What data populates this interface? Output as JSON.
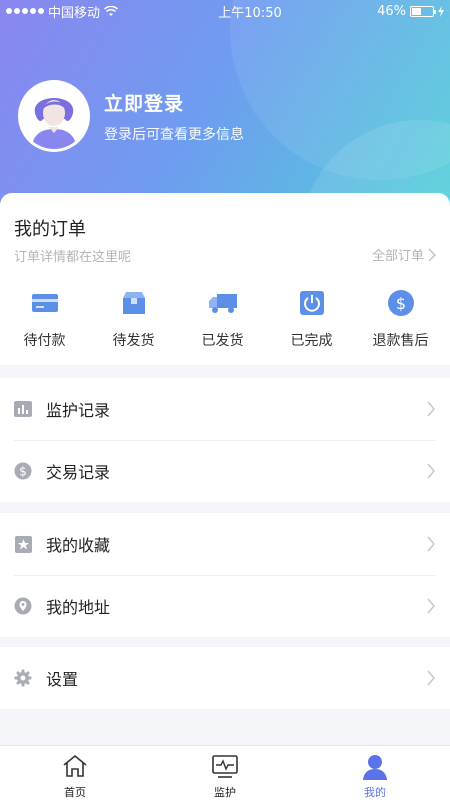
{
  "status_bar": {
    "carrier": "中国移动",
    "time": "上午10:50",
    "battery": "46%",
    "battery_level": 0.46
  },
  "profile": {
    "title": "立即登录",
    "subtitle": "登录后可查看更多信息"
  },
  "orders": {
    "title": "我的订单",
    "subtitle": "订单详情都在这里呢",
    "all_link": "全部订单",
    "items": [
      {
        "label": "待付款",
        "icon": "card-icon"
      },
      {
        "label": "待发货",
        "icon": "box-icon"
      },
      {
        "label": "已发货",
        "icon": "truck-icon"
      },
      {
        "label": "已完成",
        "icon": "power-icon"
      },
      {
        "label": "退款售后",
        "icon": "dollar-icon"
      }
    ]
  },
  "menu": {
    "monitor_records": "监护记录",
    "trade_records": "交易记录",
    "favorites": "我的收藏",
    "address": "我的地址",
    "settings": "设置"
  },
  "tabbar": {
    "home": "首页",
    "monitor": "监护",
    "mine": "我的"
  },
  "colors": {
    "accent": "#5b73e8",
    "icon_blue": "#5b8fe8",
    "icon_gray": "#a9abb4",
    "header_start": "#8a86f0",
    "header_end": "#4fd0d8"
  }
}
